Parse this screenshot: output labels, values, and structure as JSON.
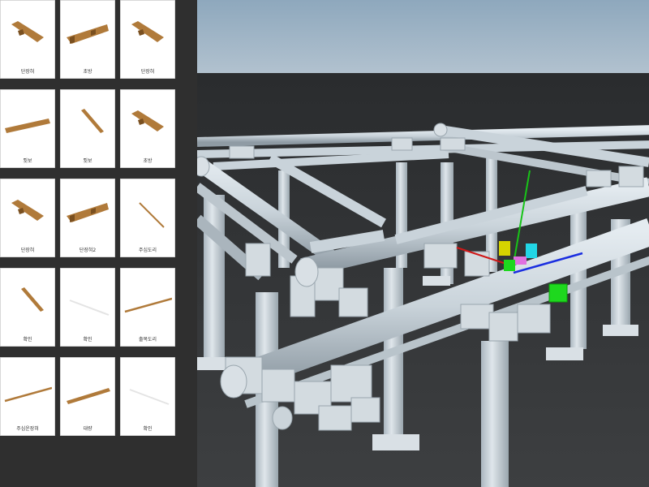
{
  "sidebar": {
    "items": [
      {
        "label": "단장혀",
        "icon": "tenon-beam-icon"
      },
      {
        "label": "초방",
        "icon": "notched-beam-icon"
      },
      {
        "label": "단장혀",
        "icon": "tenon-beam-icon"
      },
      {
        "label": "툇보",
        "icon": "rafter-beam-icon"
      },
      {
        "label": "툇보",
        "icon": "thin-beam-icon"
      },
      {
        "label": "초방",
        "icon": "tenon-beam-icon"
      },
      {
        "label": "단장혀",
        "icon": "tenon-beam-icon"
      },
      {
        "label": "단장혀2",
        "icon": "notched-beam-icon"
      },
      {
        "label": "주심도리",
        "icon": "thin-rod-icon"
      },
      {
        "label": "확인",
        "icon": "thin-beam-icon"
      },
      {
        "label": "확인",
        "icon": "white-rod-icon"
      },
      {
        "label": "출목도리",
        "icon": "long-rod-icon"
      },
      {
        "label": "주심운장혀",
        "icon": "long-rod-icon"
      },
      {
        "label": "대량",
        "icon": "long-plank-icon"
      },
      {
        "label": "확인",
        "icon": "white-rod-icon"
      }
    ]
  },
  "viewport": {
    "name": "3d-scene",
    "gizmo": {
      "x_axis_color": "#1a2ee0",
      "y_axis_color": "#18c418",
      "z_axis_color": "#d01818",
      "handle_yellow": "#d6d300",
      "handle_cyan": "#22d6e6",
      "handle_magenta": "#e070e0",
      "handle_green": "#1ed81e"
    },
    "colors": {
      "sky_top": "#8ea8bd",
      "sky_bottom": "#aebfcd",
      "ground": "#3b3d3f",
      "structure": "#c4cdd3",
      "wood": "#b07a3a"
    }
  }
}
